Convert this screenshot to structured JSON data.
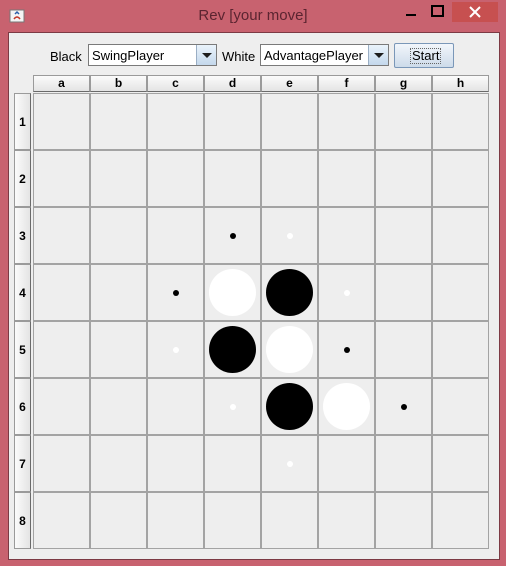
{
  "window": {
    "title": "Rev [your move]"
  },
  "controls": {
    "black_label": "Black",
    "black_player": "SwingPlayer",
    "white_label": "White",
    "white_player": "AdvantagePlayer",
    "start_label": "Start"
  },
  "board": {
    "columns": [
      "a",
      "b",
      "c",
      "d",
      "e",
      "f",
      "g",
      "h"
    ],
    "rows": [
      "1",
      "2",
      "3",
      "4",
      "5",
      "6",
      "7",
      "8"
    ],
    "pieces": [
      {
        "cell": "d4",
        "color": "white"
      },
      {
        "cell": "e4",
        "color": "black"
      },
      {
        "cell": "d5",
        "color": "black"
      },
      {
        "cell": "e5",
        "color": "white"
      },
      {
        "cell": "e6",
        "color": "black"
      },
      {
        "cell": "f6",
        "color": "white"
      }
    ],
    "hints": [
      {
        "cell": "d3",
        "color": "black"
      },
      {
        "cell": "e3",
        "color": "white"
      },
      {
        "cell": "c4",
        "color": "black"
      },
      {
        "cell": "f4",
        "color": "white"
      },
      {
        "cell": "c5",
        "color": "white"
      },
      {
        "cell": "f5",
        "color": "black"
      },
      {
        "cell": "d6",
        "color": "white"
      },
      {
        "cell": "g6",
        "color": "black"
      },
      {
        "cell": "e7",
        "color": "white"
      }
    ]
  }
}
